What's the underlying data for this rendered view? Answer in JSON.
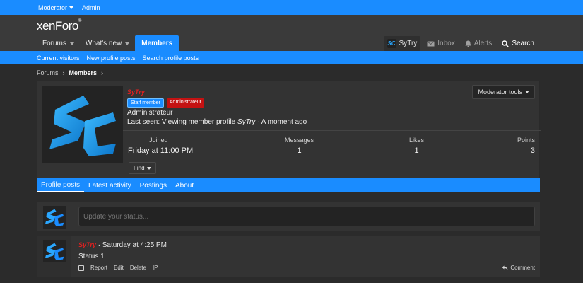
{
  "topbar": {
    "moderator": "Moderator",
    "admin": "Admin"
  },
  "logo": {
    "text": "xenForo",
    "mark": "®"
  },
  "nav": {
    "forums": "Forums",
    "whats_new": "What's new",
    "members": "Members"
  },
  "nav_right": {
    "user": "SyTry",
    "avatar_letters": "SC",
    "inbox": "Inbox",
    "alerts": "Alerts",
    "search": "Search"
  },
  "subnav": [
    "Current visitors",
    "New profile posts",
    "Search profile posts"
  ],
  "breadcrumb": {
    "forums": "Forums",
    "members": "Members"
  },
  "profile": {
    "username": "SyTry",
    "badge_staff": "Staff member",
    "badge_admin": "Administrateur",
    "user_title": "Administrateur",
    "last_seen_prefix": "Last seen: Viewing member profile ",
    "last_seen_target": "SyTry",
    "last_seen_time": " · A moment ago",
    "moderator_tools": "Moderator tools",
    "joined_label": "Joined",
    "joined_value": "Friday at 11:00 PM",
    "messages_label": "Messages",
    "messages_value": "1",
    "likes_label": "Likes",
    "likes_value": "1",
    "points_label": "Points",
    "points_value": "3",
    "find": "Find"
  },
  "tabs": [
    "Profile posts",
    "Latest activity",
    "Postings",
    "About"
  ],
  "status": {
    "placeholder": "Update your status..."
  },
  "post": {
    "author": "SyTry",
    "time": " · Saturday at 4:25 PM",
    "body": "Status 1",
    "report": "Report",
    "edit": "Edit",
    "delete": "Delete",
    "ip": "IP",
    "comment": "Comment"
  },
  "colors": {
    "accent": "#1a8cff",
    "username": "#e02020",
    "admin_badge": "#c41212",
    "logo_blue": "#2aa7ff"
  }
}
